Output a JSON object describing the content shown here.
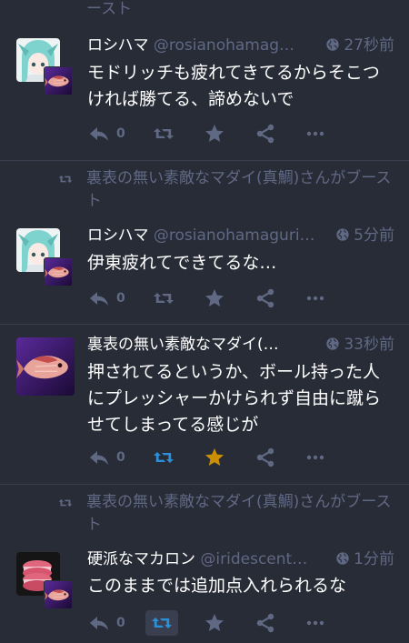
{
  "colors": {
    "background": "#282c37",
    "muted": "#606984",
    "boost_active": "#2b90d9",
    "fav_active": "#ca8f04"
  },
  "top_cut_text": "ースト",
  "statuses": [
    {
      "display_name": "ロシハマ",
      "acct": "@rosianohamaguri",
      "acct_shown": "@rosianohamag…",
      "time": "27秒前",
      "content": "モドリッチも疲れてきてるからそこつければ勝てる、諦めないで",
      "reply_count": "0",
      "avatar": "anime-girl-avatar",
      "boosted_by_avatar": "fish-avatar"
    },
    {
      "boost_label": "裏表の無い素敵なマダイ(真鯛)さんがブースト",
      "display_name": "ロシハマ",
      "acct_shown": "@rosianohamaguri…",
      "time": "5分前",
      "content": "伊東疲れてできてるな…",
      "reply_count": "0"
    },
    {
      "display_name": "裏表の無い素敵なマダイ(…",
      "time": "33秒前",
      "content": "押されてるというか、ボール持った人にプレッシャーかけられず自由に蹴らせてしまってる感じが",
      "reply_count": "0",
      "boosted": true,
      "favourited": true
    },
    {
      "boost_label": "裏表の無い素敵なマダイ(真鯛)さんがブースト",
      "display_name": "硬派なマカロン",
      "acct_shown": "@iridescent…",
      "time": "1分前",
      "content": "このままでは追加点入れられるな",
      "reply_count": "0",
      "boosted": true
    }
  ]
}
